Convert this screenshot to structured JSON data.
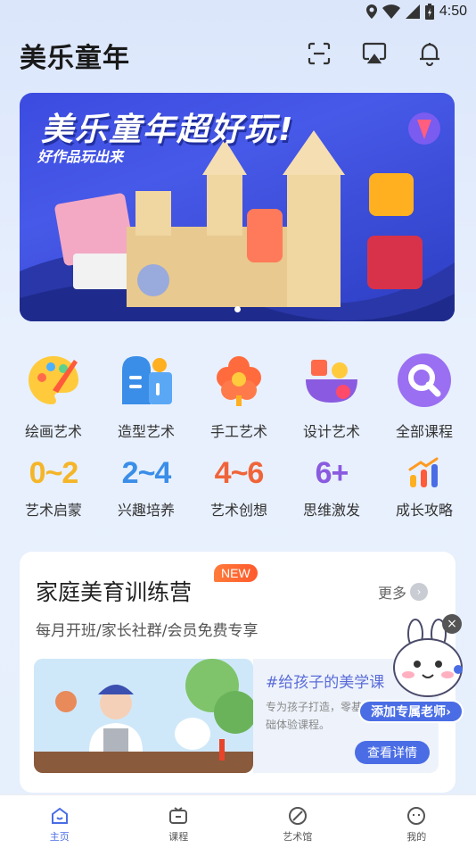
{
  "status": {
    "time": "4:50"
  },
  "header": {
    "title": "美乐童年"
  },
  "banner": {
    "title": "美乐童年超好玩!",
    "subtitle": "好作品玩出来",
    "slides": 2,
    "active_slide": 1
  },
  "categories": [
    {
      "label": "绘画艺术",
      "icon": "palette-icon"
    },
    {
      "label": "造型艺术",
      "icon": "building-icon"
    },
    {
      "label": "手工艺术",
      "icon": "flower-icon"
    },
    {
      "label": "设计艺术",
      "icon": "bowl-icon"
    },
    {
      "label": "全部课程",
      "icon": "search-icon"
    }
  ],
  "ages": [
    {
      "num": "0~2",
      "label": "艺术启蒙",
      "color": "#f5b529"
    },
    {
      "num": "2~4",
      "label": "兴趣培养",
      "color": "#3a8ee8"
    },
    {
      "num": "4~6",
      "label": "艺术创想",
      "color": "#f0643a"
    },
    {
      "num": "6+",
      "label": "思维激发",
      "color": "#8a5be0"
    },
    {
      "num": "",
      "label": "成长攻略",
      "color": "#4a6de5"
    }
  ],
  "card": {
    "title": "家庭美育训练营",
    "badge": "NEW",
    "more": "更多",
    "subtitle": "每月开班/家长社群/会员免费专享",
    "promo_title": "#给孩子的美学课",
    "promo_desc": "专为孩子打造，零基础体验课程。",
    "promo_button": "查看详情"
  },
  "floating": {
    "add_teacher": "添加专属老师›"
  },
  "tabs": [
    {
      "label": "主页",
      "active": true
    },
    {
      "label": "课程",
      "active": false
    },
    {
      "label": "艺术馆",
      "active": false
    },
    {
      "label": "我的",
      "active": false
    }
  ],
  "colors": {
    "accent": "#4a6de5",
    "badge": "#ff6a32"
  }
}
